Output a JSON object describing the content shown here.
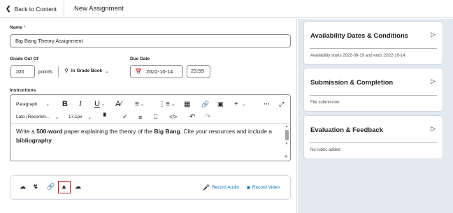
{
  "topbar": {
    "back_label": "Back to Content",
    "title": "New Assignment"
  },
  "form": {
    "name_label": "Name",
    "name_required": "*",
    "name_value": "Big Bang Theory Assignment",
    "grade_label": "Grade Out Of",
    "grade_value": "100",
    "points_label": "points",
    "in_grade_book": "In Grade Book",
    "due_label": "Due Date",
    "due_date": "2022-10-14",
    "due_time": "23:59",
    "instructions_label": "Instructions"
  },
  "toolbar": {
    "paragraph": "Paragraph",
    "bold": "B",
    "italic": "I",
    "underline": "U",
    "font": "Lato (Recomm...",
    "size": "17.1px",
    "more": "···",
    "plus": "+"
  },
  "editor": {
    "t1": "Write a ",
    "b1": "500-word",
    "t2": " paper explaining the theory of the ",
    "b2": "Big Bang",
    "t3": ". Cite your resources and include a ",
    "b3": "bibliography",
    "t4": "."
  },
  "attachments": {
    "record_audio": "Record Audio",
    "record_video": "Record Video"
  },
  "cards": [
    {
      "title": "Availability Dates & Conditions",
      "sub": "Availability starts 2022-09-19 and ends 2022-10-14"
    },
    {
      "title": "Submission & Completion",
      "sub": "File submission"
    },
    {
      "title": "Evaluation & Feedback",
      "sub": "No rubric added"
    }
  ],
  "colors": {
    "link": "#006fbf",
    "highlight": "#cd2026",
    "sidebar": "#e3e9f1"
  }
}
